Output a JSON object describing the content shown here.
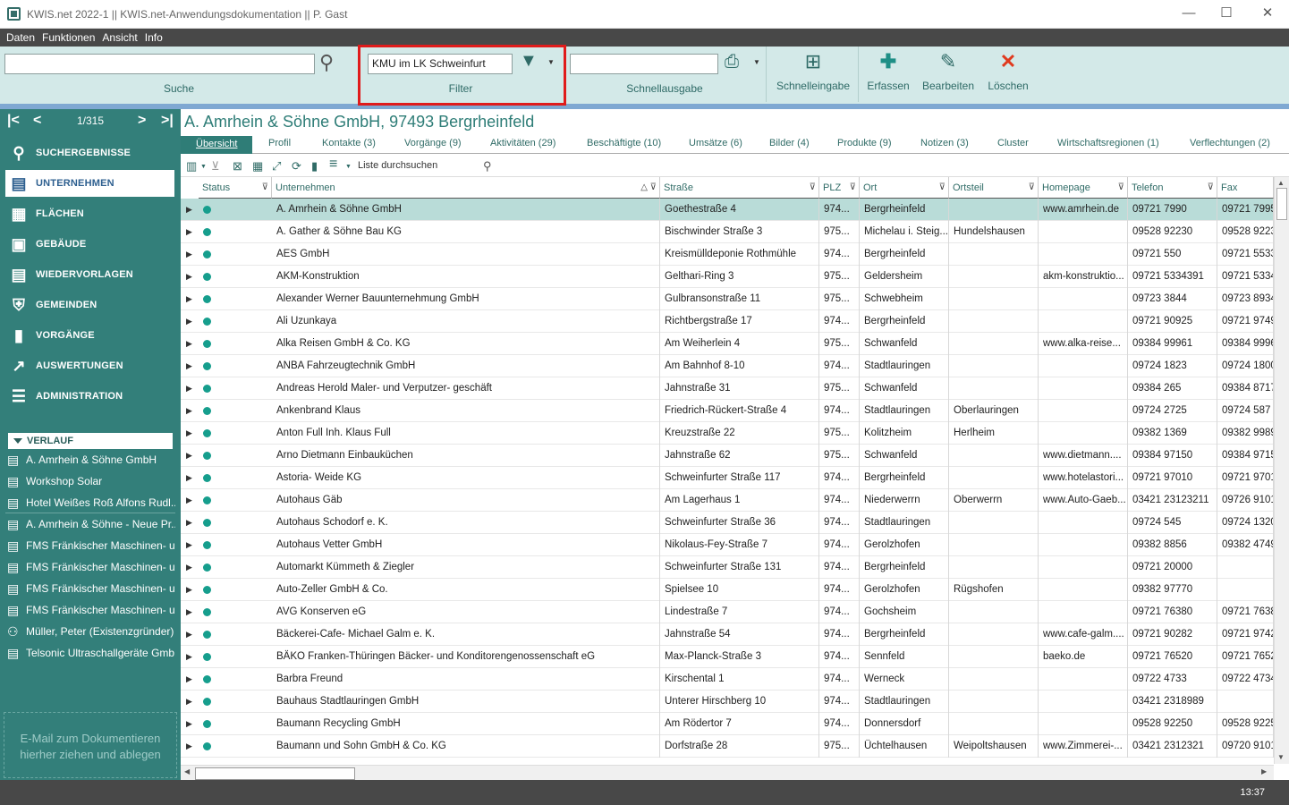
{
  "window": {
    "title": "KWIS.net 2022-1 || KWIS.net-Anwendungsdokumentation || P. Gast"
  },
  "menu": [
    "Daten",
    "Funktionen",
    "Ansicht",
    "Info"
  ],
  "ribbon": {
    "search": {
      "value": "",
      "label": "Suche"
    },
    "filter": {
      "value": "KMU im LK Schweinfurt",
      "label": "Filter"
    },
    "quickprint": {
      "value": "",
      "label": "Schnellausgabe"
    },
    "buttons": {
      "schnelleingabe": "Schnelleingabe",
      "erfassen": "Erfassen",
      "bearbeiten": "Bearbeiten",
      "loeschen": "Löschen"
    }
  },
  "pager": {
    "count": "1/315"
  },
  "nav": [
    {
      "label": "SUCHERGEBNISSE",
      "icon": "search-icon"
    },
    {
      "label": "UNTERNEHMEN",
      "icon": "company-icon"
    },
    {
      "label": "FLÄCHEN",
      "icon": "area-icon"
    },
    {
      "label": "GEBÄUDE",
      "icon": "building-icon"
    },
    {
      "label": "WIEDERVORLAGEN",
      "icon": "resubmission-icon"
    },
    {
      "label": "GEMEINDEN",
      "icon": "shield-icon"
    },
    {
      "label": "VORGÄNGE",
      "icon": "process-icon"
    },
    {
      "label": "AUSWERTUNGEN",
      "icon": "chart-icon"
    },
    {
      "label": "ADMINISTRATION",
      "icon": "settings-icon"
    }
  ],
  "verlauf": {
    "title": "VERLAUF",
    "items": [
      "A. Amrhein & Söhne GmbH",
      "Workshop Solar",
      "Hotel Weißes Roß Alfons Rudl...",
      "A. Amrhein & Söhne - Neue Pr...",
      "FMS Fränkischer Maschinen- u...",
      "FMS Fränkischer Maschinen- u...",
      "FMS Fränkischer Maschinen- u...",
      "FMS Fränkischer Maschinen- u...",
      "Müller, Peter (Existenzgründer)",
      "Telsonic Ultraschallgeräte Gmb..."
    ]
  },
  "dropzone": "E-Mail zum Dokumentieren hierher ziehen und ablegen",
  "company_title": "A. Amrhein & Söhne GmbH, 97493 Bergrheinfeld",
  "tabs": [
    "Übersicht",
    "Profil",
    "Kontakte (3)",
    "Vorgänge (9)",
    "Aktivitäten (29)",
    "Beschäftigte (10)",
    "Umsätze (6)",
    "Bilder (4)",
    "Produkte (9)",
    "Notizen (3)",
    "Cluster",
    "Wirtschaftsregionen (1)",
    "Verflechtungen (2)"
  ],
  "list_search": {
    "placeholder": "Liste durchsuchen"
  },
  "columns": [
    "Status",
    "Unternehmen",
    "Straße",
    "PLZ",
    "Ort",
    "Ortsteil",
    "Homepage",
    "Telefon",
    "Fax"
  ],
  "rows": [
    [
      "A. Amrhein & Söhne GmbH",
      "Goethestraße 4",
      "974...",
      "Bergrheinfeld",
      "",
      "www.amrhein.de",
      "09721 7990",
      "09721 7995"
    ],
    [
      "A. Gather & Söhne Bau KG",
      "Bischwinder Straße 3",
      "975...",
      "Michelau i. Steig...",
      "Hundelshausen",
      "",
      "09528 92230",
      "09528 9223"
    ],
    [
      "AES GmbH",
      "Kreismülldeponie Rothmühle",
      "974...",
      "Bergrheinfeld",
      "",
      "",
      "09721 550",
      "09721 5533"
    ],
    [
      "AKM-Konstruktion",
      "Gelthari-Ring 3",
      "975...",
      "Geldersheim",
      "",
      "akm-konstruktio...",
      "09721 5334391",
      "09721 5334"
    ],
    [
      "Alexander Werner Bauunternehmung GmbH",
      "Gulbransonstraße 11",
      "975...",
      "Schwebheim",
      "",
      "",
      "09723 3844",
      "09723 8934"
    ],
    [
      "Ali Uzunkaya",
      "Richtbergstraße 17",
      "974...",
      "Bergrheinfeld",
      "",
      "",
      "09721 90925",
      "09721 9749"
    ],
    [
      "Alka Reisen GmbH & Co. KG",
      "Am Weiherlein 4",
      "975...",
      "Schwanfeld",
      "",
      "www.alka-reise...",
      "09384 99961",
      "09384 9996"
    ],
    [
      "ANBA Fahrzeugtechnik GmbH",
      "Am Bahnhof 8-10",
      "974...",
      "Stadtlauringen",
      "",
      "",
      "09724 1823",
      "09724 1800"
    ],
    [
      "Andreas Herold Maler- und Verputzer- geschäft",
      "Jahnstraße 31",
      "975...",
      "Schwanfeld",
      "",
      "",
      "09384 265",
      "09384 8717"
    ],
    [
      "Ankenbrand Klaus",
      "Friedrich-Rückert-Straße 4",
      "974...",
      "Stadtlauringen",
      "Oberlauringen",
      "",
      "09724 2725",
      "09724 587"
    ],
    [
      "Anton Full Inh. Klaus Full",
      "Kreuzstraße 22",
      "975...",
      "Kolitzheim",
      "Herlheim",
      "",
      "09382 1369",
      "09382 9989"
    ],
    [
      "Arno Dietmann Einbauküchen",
      "Jahnstraße 62",
      "975...",
      "Schwanfeld",
      "",
      "www.dietmann....",
      "09384 97150",
      "09384 9715"
    ],
    [
      "Astoria- Weide KG",
      "Schweinfurter Straße 117",
      "974...",
      "Bergrheinfeld",
      "",
      "www.hotelastori...",
      "09721 97010",
      "09721 9701"
    ],
    [
      "Autohaus Gäb",
      "Am Lagerhaus 1",
      "974...",
      "Niederwerrn",
      "Oberwerrn",
      "www.Auto-Gaeb...",
      "03421 23123211",
      "09726 9101"
    ],
    [
      "Autohaus Schodorf e. K.",
      "Schweinfurter Straße 36",
      "974...",
      "Stadtlauringen",
      "",
      "",
      "09724 545",
      "09724 1320"
    ],
    [
      "Autohaus Vetter GmbH",
      "Nikolaus-Fey-Straße 7",
      "974...",
      "Gerolzhofen",
      "",
      "",
      "09382 8856",
      "09382 4749"
    ],
    [
      "Automarkt Kümmeth & Ziegler",
      "Schweinfurter Straße 131",
      "974...",
      "Bergrheinfeld",
      "",
      "",
      "09721 20000",
      ""
    ],
    [
      "Auto-Zeller GmbH & Co.",
      "Spielsee 10",
      "974...",
      "Gerolzhofen",
      "Rügshofen",
      "",
      "09382 97770",
      ""
    ],
    [
      "AVG Konserven eG",
      "Lindestraße 7",
      "974...",
      "Gochsheim",
      "",
      "",
      "09721 76380",
      "09721 7638"
    ],
    [
      "Bäckerei-Cafe- Michael Galm e. K.",
      "Jahnstraße 54",
      "974...",
      "Bergrheinfeld",
      "",
      "www.cafe-galm....",
      "09721 90282",
      "09721 9742"
    ],
    [
      "BÄKO Franken-Thüringen Bäcker- und Konditorengenossenschaft eG",
      "Max-Planck-Straße 3",
      "974...",
      "Sennfeld",
      "",
      "baeko.de",
      "09721 76520",
      "09721 7652"
    ],
    [
      "Barbra Freund",
      "Kirschental 1",
      "974...",
      "Werneck",
      "",
      "",
      "09722 4733",
      "09722 4734"
    ],
    [
      "Bauhaus Stadtlauringen GmbH",
      "Unterer Hirschberg 10",
      "974...",
      "Stadtlauringen",
      "",
      "",
      "03421 2318989",
      ""
    ],
    [
      "Baumann Recycling GmbH",
      "Am Rödertor 7",
      "974...",
      "Donnersdorf",
      "",
      "",
      "09528 92250",
      "09528 9225"
    ],
    [
      "Baumann und Sohn GmbH & Co. KG",
      "Dorfstraße 28",
      "975...",
      "Üchtelhausen",
      "Weipoltshausen",
      "www.Zimmerei-...",
      "03421 2312321",
      "09720 9101"
    ]
  ],
  "statusbar": {
    "clock": "13:37"
  }
}
